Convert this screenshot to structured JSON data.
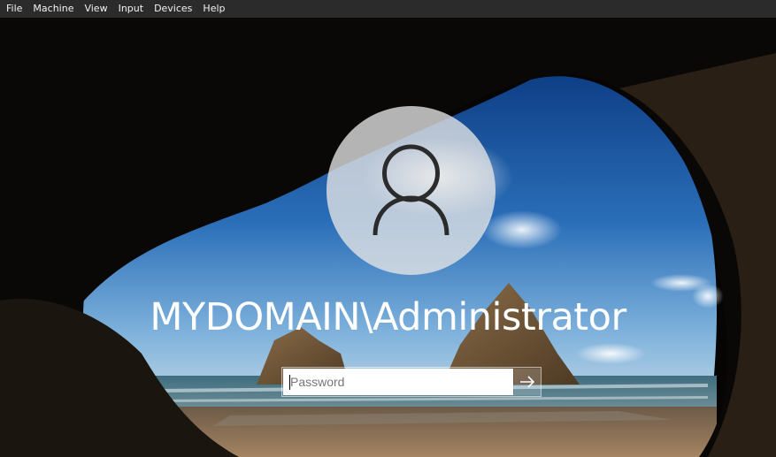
{
  "menubar": {
    "items": [
      "File",
      "Machine",
      "View",
      "Input",
      "Devices",
      "Help"
    ]
  },
  "login": {
    "username": "MYDOMAIN\\Administrator",
    "password_placeholder": "Password",
    "password_value": ""
  },
  "icons": {
    "avatar": "user-silhouette-icon",
    "submit": "arrow-right-icon"
  },
  "colors": {
    "menubar_bg": "#2b2b2b",
    "menubar_text": "#f2f2f2",
    "username_text": "#ffffff",
    "input_bg": "#ffffff"
  }
}
